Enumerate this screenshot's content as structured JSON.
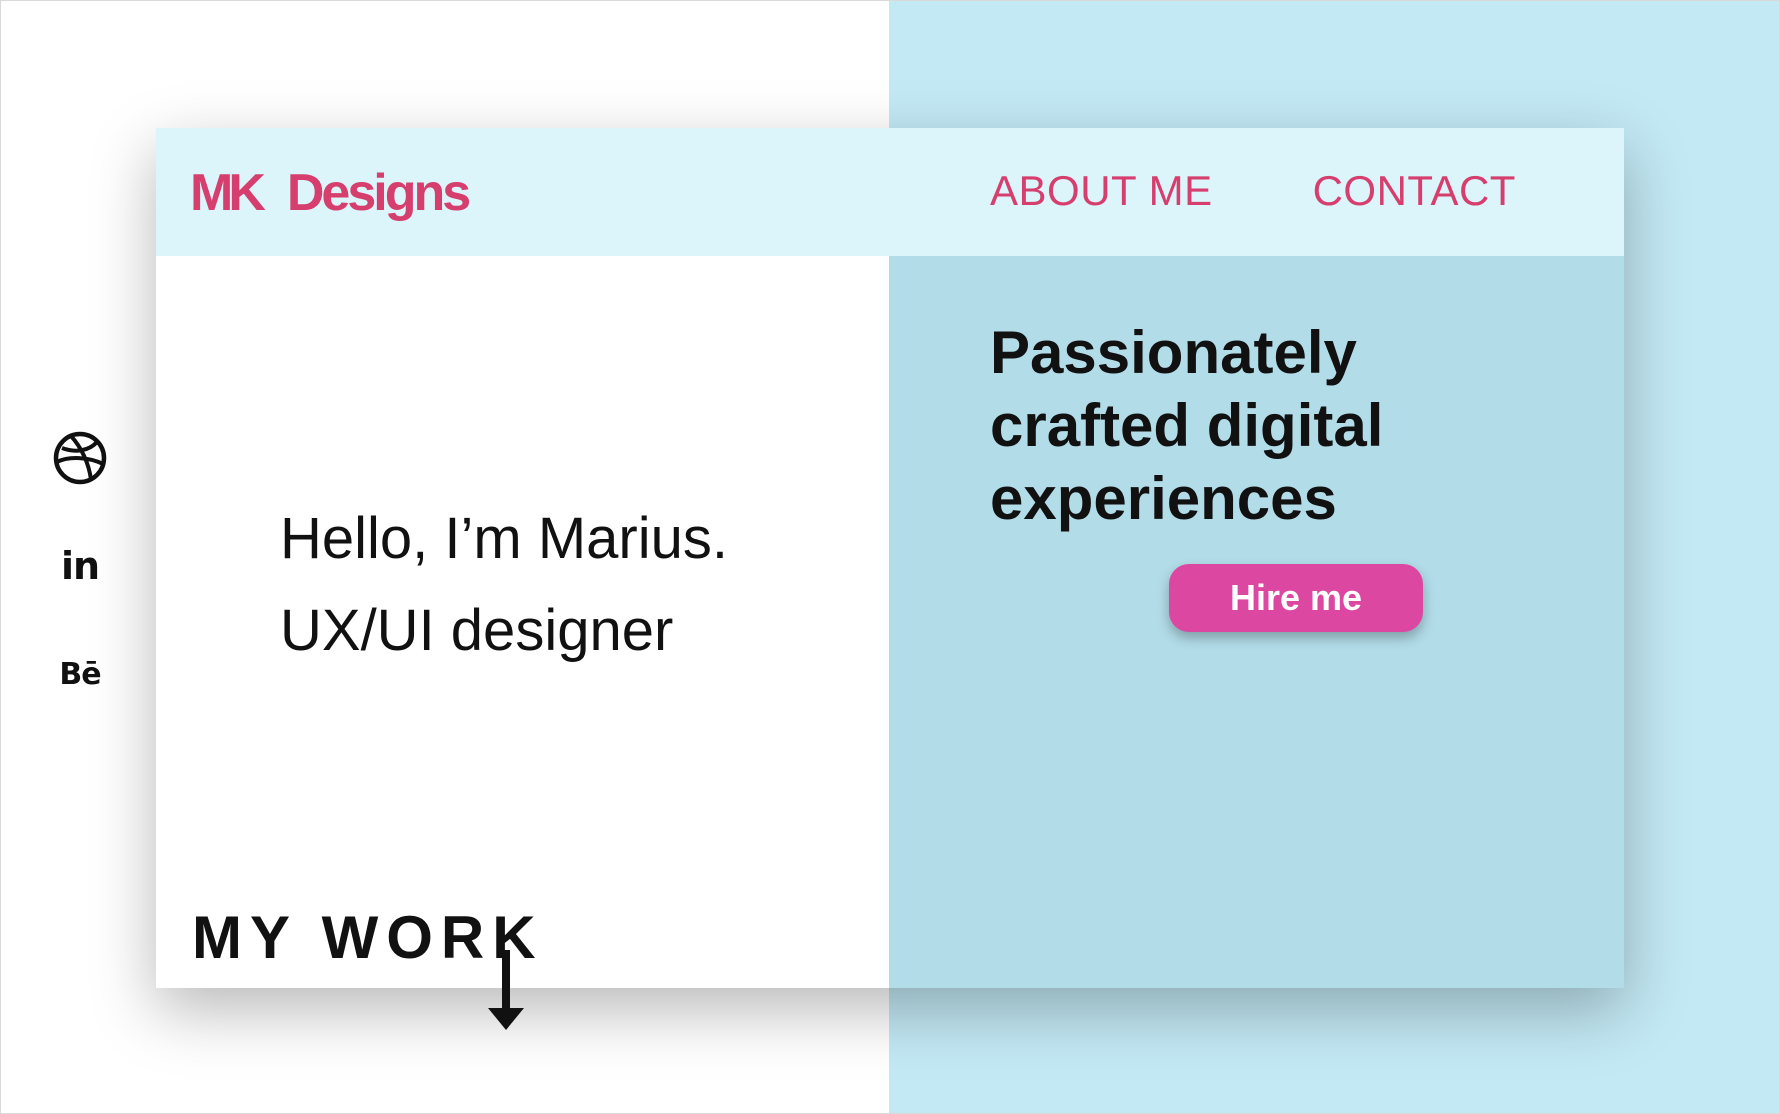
{
  "brand": {
    "logo_mk": "MK",
    "logo_designs": "Designs",
    "color": "#d63e6e"
  },
  "nav": {
    "items": [
      {
        "label": "ABOUT ME"
      },
      {
        "label": "CONTACT"
      }
    ]
  },
  "social": {
    "items": [
      {
        "icon": "dribbble-icon",
        "label": ""
      },
      {
        "icon": "linkedin-icon",
        "label": "in"
      },
      {
        "icon": "behance-icon",
        "label": "Bē"
      }
    ]
  },
  "hero": {
    "greeting_line1": "Hello, I’m Marius.",
    "greeting_line2": "UX/UI designer",
    "headline_line1": "Passionately",
    "headline_line2": "crafted digital",
    "headline_line3": "experiences",
    "cta_label": "Hire me",
    "cta_color": "#db47a1"
  },
  "work": {
    "label": "MY WORK",
    "arrow_icon": "arrow-down-icon"
  },
  "colors": {
    "page_right_bg": "#c3e9f5",
    "card_right_bg": "#b2dce8",
    "navbar_bg": "#dcf5fb",
    "text": "#111111"
  }
}
